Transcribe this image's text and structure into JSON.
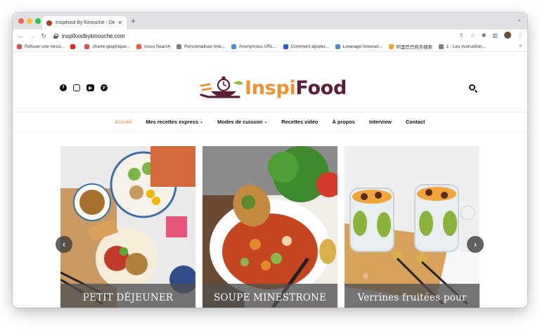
{
  "browser": {
    "tab_title": "Inspifood By Kinouche - Des r",
    "tab_close": "✕",
    "new_tab": "+",
    "tab_menu": "⌄",
    "url": "inspifoodbykinouche.com",
    "nav": {
      "back": "←",
      "forward": "→",
      "reload": "↻"
    },
    "toolbar_icons": [
      "share-icon",
      "star-icon",
      "puzzle-icon",
      "sidebar-icon",
      "avatar",
      "kebab-menu-icon"
    ],
    "toolbar_glyphs": {
      "share": "⇪",
      "star": "☆",
      "extensions": "✱",
      "sidebar": "▥",
      "menu": "⋮"
    }
  },
  "bookmarks": [
    {
      "label": "Refuser une missi...",
      "color": "#d9534f"
    },
    {
      "label": "",
      "color": "#e62117"
    },
    {
      "label": "charte-graphique...",
      "color": "#d9534f"
    },
    {
      "label": "issuu Search",
      "color": "#ef5b39"
    },
    {
      "label": "Personnalisez Inte...",
      "color": "#7d7d7d"
    },
    {
      "label": "Anonymous URL...",
      "color": "#4a90d9"
    },
    {
      "label": "Comment ajouter...",
      "color": "#2a5bd7"
    },
    {
      "label": "Leverage browser...",
      "color": "#4a8fd6"
    },
    {
      "label": "阿里巴巴商务搜索",
      "color": "#f5a623"
    },
    {
      "label": "1 - Les instruction...",
      "color": "#7d7d7d"
    }
  ],
  "bookmarks_more": "»",
  "site": {
    "logo": {
      "part1": "Inspi",
      "part2": "Food"
    },
    "social": [
      "facebook-icon",
      "instagram-icon",
      "youtube-icon",
      "pinterest-icon"
    ],
    "social_glyphs": {
      "facebook": "f",
      "instagram": "",
      "youtube": "▶",
      "pinterest": "p"
    },
    "menu": [
      {
        "label": "Accueil",
        "active": true,
        "dropdown": false
      },
      {
        "label": "Mes recettes express",
        "active": false,
        "dropdown": true
      },
      {
        "label": "Modes de cuisson",
        "active": false,
        "dropdown": true
      },
      {
        "label": "Recettes vidéo",
        "active": false,
        "dropdown": false
      },
      {
        "label": "À propos",
        "active": false,
        "dropdown": false
      },
      {
        "label": "Interview",
        "active": false,
        "dropdown": false
      },
      {
        "label": "Contact",
        "active": false,
        "dropdown": false
      }
    ],
    "dropdown_glyph": "⌄",
    "slides": [
      {
        "caption": "PETIT DÉJEUNER"
      },
      {
        "caption": "SOUPE MINESTRONE"
      },
      {
        "caption": "Verrines fruitées pour"
      }
    ],
    "arrows": {
      "prev": "‹",
      "next": "›"
    }
  }
}
